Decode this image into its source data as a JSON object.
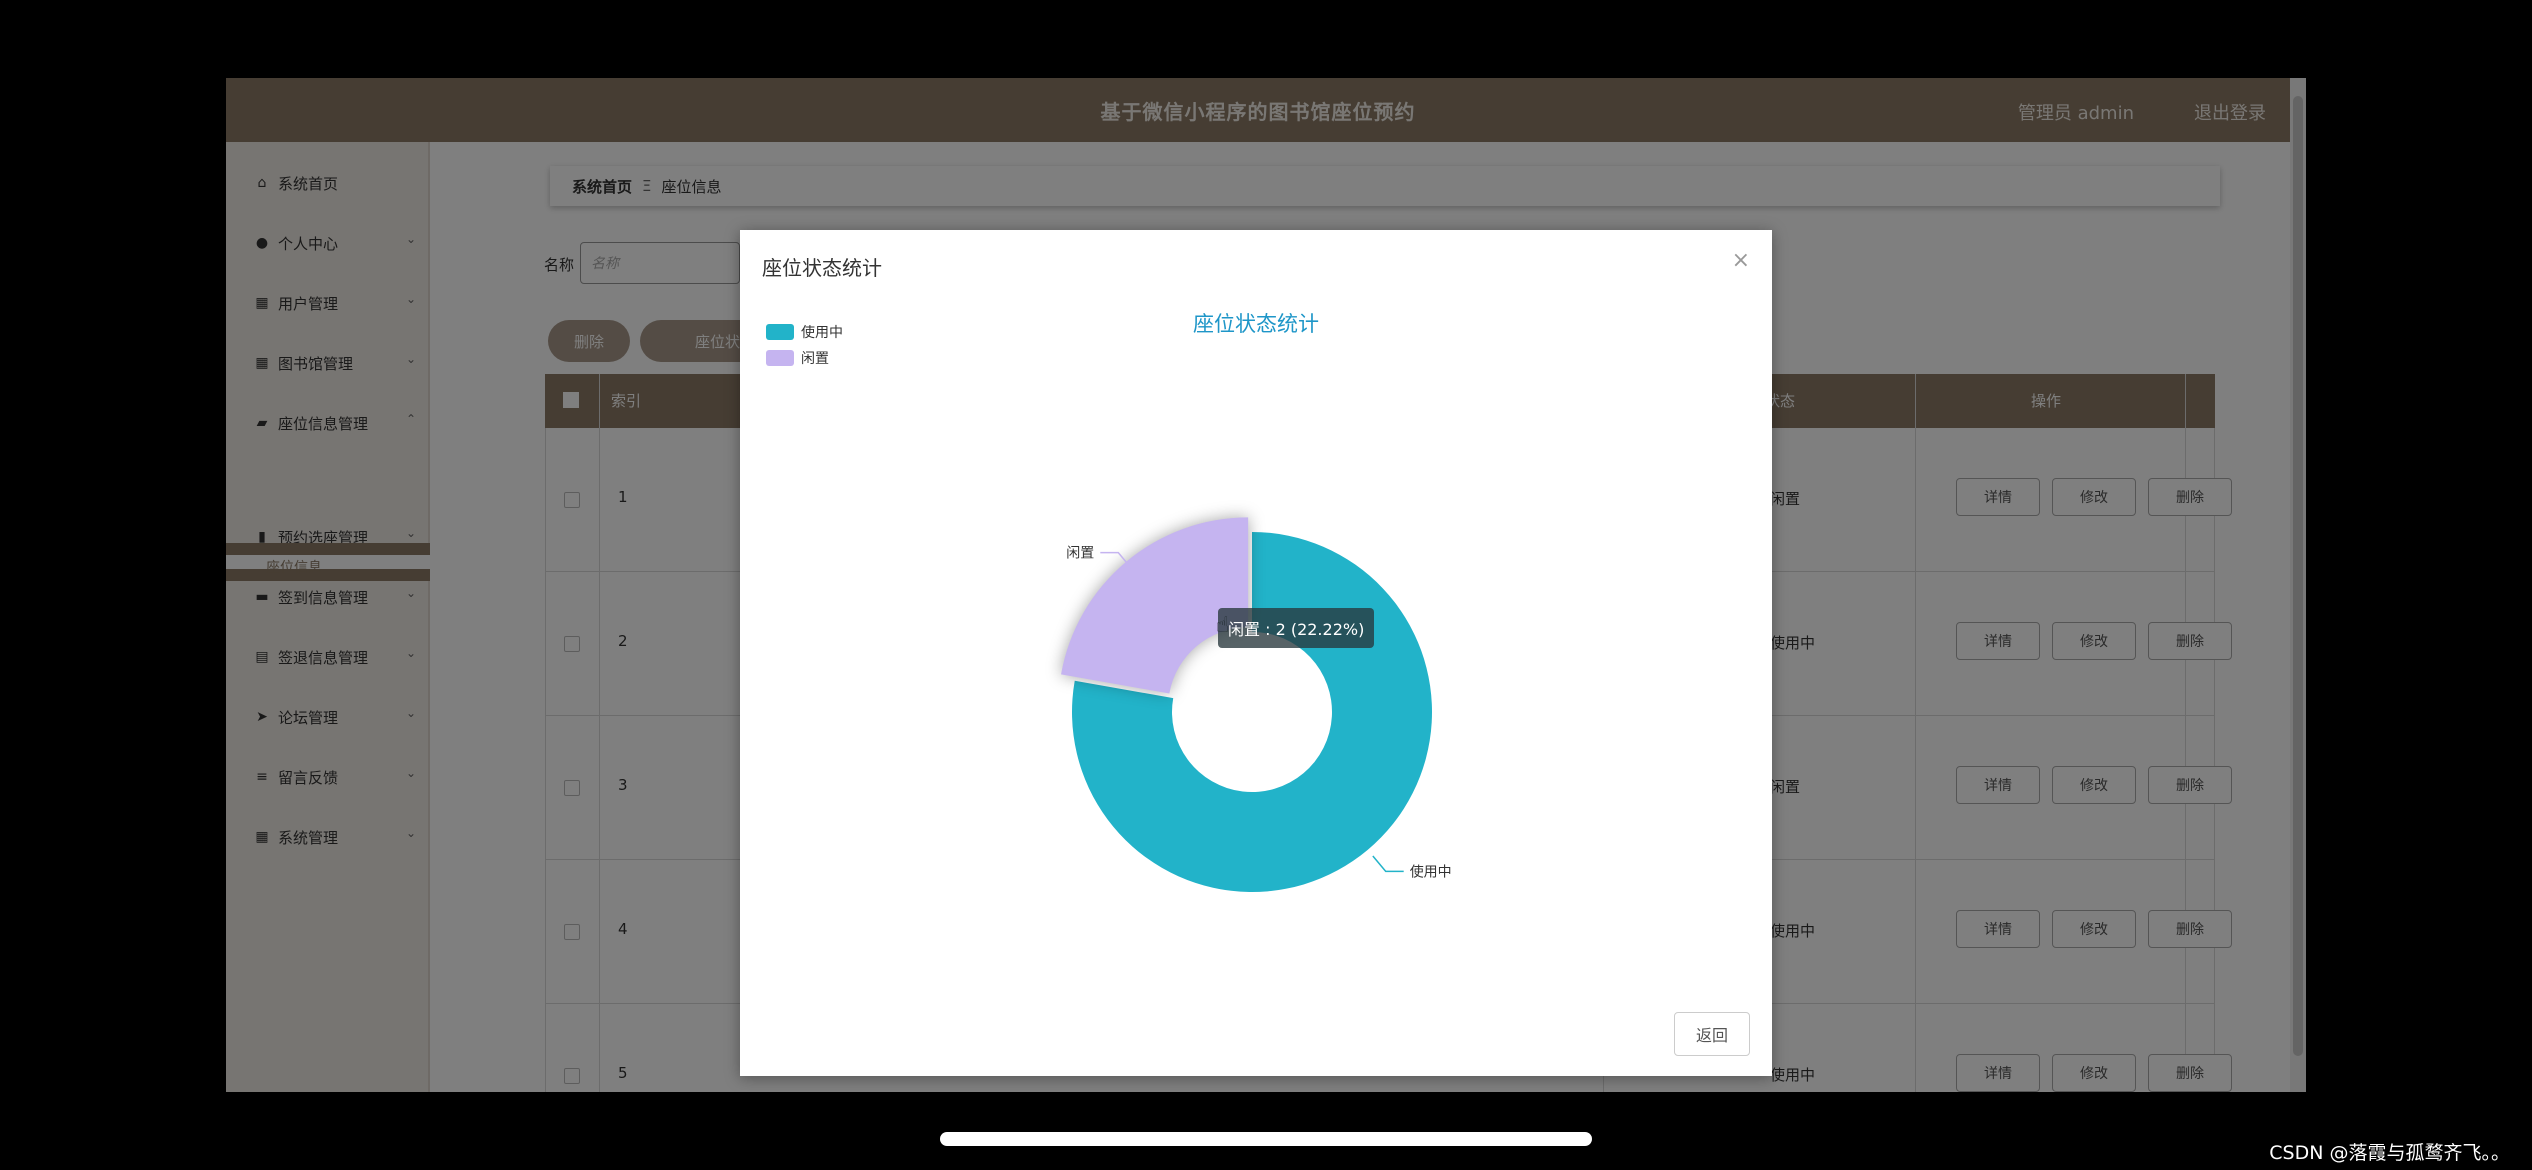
{
  "header": {
    "title": "基于微信小程序的图书馆座位预约",
    "admin": "管理员 admin",
    "logout": "退出登录"
  },
  "sidebar": {
    "items": [
      {
        "label": "系统首页",
        "icon": "home-icon",
        "glyph": "⌂"
      },
      {
        "label": "个人中心",
        "icon": "user-icon",
        "glyph": "●"
      },
      {
        "label": "用户管理",
        "icon": "grid-icon",
        "glyph": "▦"
      },
      {
        "label": "图书馆管理",
        "icon": "grid-icon",
        "glyph": "▦"
      },
      {
        "label": "座位信息管理",
        "icon": "chair-icon",
        "glyph": "▰"
      },
      {
        "label": "预约选座管理",
        "icon": "bar-chart-icon",
        "glyph": "▮"
      },
      {
        "label": "签到信息管理",
        "icon": "monitor-icon",
        "glyph": "▬"
      },
      {
        "label": "签退信息管理",
        "icon": "clipboard-icon",
        "glyph": "▤"
      },
      {
        "label": "论坛管理",
        "icon": "send-icon",
        "glyph": "➤"
      },
      {
        "label": "留言反馈",
        "icon": "sliders-icon",
        "glyph": "≡"
      },
      {
        "label": "系统管理",
        "icon": "grid-icon",
        "glyph": "▦"
      }
    ],
    "active_sub": "座位信息"
  },
  "breadcrumb": {
    "home": "系统首页",
    "sep": "Ξ",
    "current": "座位信息"
  },
  "search": {
    "label": "名称",
    "placeholder": "名称"
  },
  "buttons": {
    "delete": "删除",
    "stats": "座位状态统计"
  },
  "table": {
    "headers": {
      "index": "索引",
      "status": "状态",
      "actions": "操作"
    },
    "rows": [
      {
        "index": "1",
        "status": "闲置"
      },
      {
        "index": "2",
        "status": "使用中"
      },
      {
        "index": "3",
        "status": "闲置"
      },
      {
        "index": "4",
        "status": "使用中"
      },
      {
        "index": "5",
        "status": "使用中"
      }
    ],
    "row_actions": [
      "详情",
      "修改",
      "删除"
    ]
  },
  "dialog": {
    "title": "座位状态统计",
    "back": "返回",
    "close": "×",
    "tooltip": "闲置 : 2 (22.22%)"
  },
  "chart_data": {
    "type": "pie",
    "title": "座位状态统计",
    "legend_position": "top-left",
    "categories": [
      "使用中",
      "闲置"
    ],
    "values": [
      7,
      2
    ],
    "colors": [
      "#22b3c9",
      "#c5b4f0"
    ],
    "highlighted": "闲置"
  },
  "watermark": "CSDN @落霞与孤鹜齐飞。。"
}
